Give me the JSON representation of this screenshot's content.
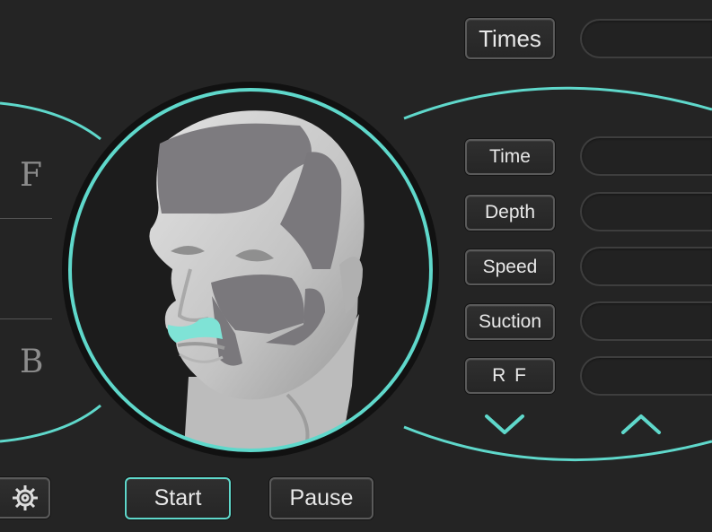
{
  "left_panel": {
    "front_label": "F",
    "back_label": "B"
  },
  "parameters": {
    "times_label": "Times",
    "time_label": "Time",
    "depth_label": "Depth",
    "speed_label": "Speed",
    "suction_label": "Suction",
    "rf_label": "R F",
    "times_value": "",
    "time_value": "",
    "depth_value": "",
    "speed_value": "",
    "suction_value": "",
    "rf_value": ""
  },
  "controls": {
    "start_label": "Start",
    "pause_label": "Pause"
  },
  "icons": {
    "settings": "gear-icon",
    "down": "chevron-down-icon",
    "up": "chevron-up-icon"
  },
  "colors": {
    "accent": "#5fd8cb",
    "background": "#242424",
    "selected_zone": "#7fe3d6"
  }
}
